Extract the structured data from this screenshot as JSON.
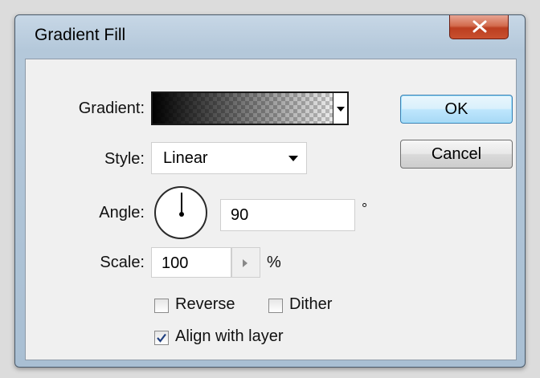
{
  "window": {
    "title": "Gradient Fill"
  },
  "form": {
    "gradient_label": "Gradient:",
    "style_label": "Style:",
    "style_value": "Linear",
    "angle_label": "Angle:",
    "angle_value": "90",
    "angle_unit": "°",
    "scale_label": "Scale:",
    "scale_value": "100",
    "scale_unit": "%",
    "reverse_label": "Reverse",
    "reverse_checked": false,
    "dither_label": "Dither",
    "dither_checked": false,
    "align_label": "Align with layer",
    "align_checked": true
  },
  "buttons": {
    "ok_label": "OK",
    "cancel_label": "Cancel"
  },
  "icons": {
    "close": "close-icon",
    "dropdown": "chevron-down-icon",
    "stepper": "triangle-right-icon",
    "check": "checkmark-icon"
  },
  "colors": {
    "title_bar": "#b4c8da",
    "close_button": "#c9502f",
    "ok_button": "#bee6fd"
  }
}
